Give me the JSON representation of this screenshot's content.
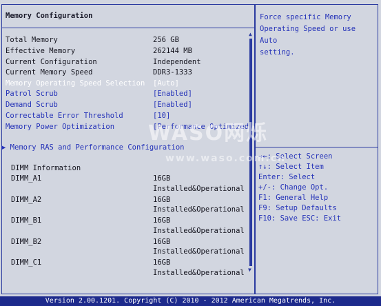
{
  "title": "Memory Configuration",
  "info_rows": [
    {
      "label": "Total Memory",
      "value": "256 GB"
    },
    {
      "label": "Effective Memory",
      "value": "262144 MB"
    },
    {
      "label": "Current Configuration",
      "value": "Independent"
    },
    {
      "label": "Current Memory Speed",
      "value": "DDR3-1333"
    }
  ],
  "options": [
    {
      "label": "Memory Operating Speed Selection",
      "value": "[Auto]"
    },
    {
      "label": "Patrol Scrub",
      "value": "[Enabled]"
    },
    {
      "label": "Demand Scrub",
      "value": "[Enabled]"
    },
    {
      "label": "Correctable Error Threshold",
      "value": "[10]"
    },
    {
      "label": "Memory Power Optimization",
      "value": "[Performance Optimized]"
    }
  ],
  "submenu": "▶ Memory RAS and Performance Configuration",
  "dimm_header": "DIMM Information",
  "dimms": [
    {
      "name": "DIMM_A1",
      "size": "16GB",
      "status": "Installed&Operational"
    },
    {
      "name": "DIMM_A2",
      "size": "16GB",
      "status": "Installed&Operational"
    },
    {
      "name": "DIMM_B1",
      "size": "16GB",
      "status": "Installed&Operational"
    },
    {
      "name": "DIMM_B2",
      "size": "16GB",
      "status": "Installed&Operational"
    },
    {
      "name": "DIMM_C1",
      "size": "16GB",
      "status": "Installed&Operational"
    }
  ],
  "help_text": "Force specific Memory\nOperating Speed or use Auto\nsetting.",
  "keys": [
    "→←: Select Screen",
    "↑↓: Select Item",
    "Enter: Select",
    "+/-: Change Opt.",
    "F1: General Help",
    "F9: Setup Defaults",
    "F10: Save  ESC: Exit"
  ],
  "footer": "Version 2.00.1201. Copyright (C) 2010 - 2012 American Megatrends, Inc.",
  "watermark": "WASO网烁",
  "watermark_url": "www.waso.com.cn",
  "colors": {
    "background": "#d2d6e0",
    "frame": "#2a3aa0",
    "option_text": "#2432b8",
    "selected_text": "#ffffff",
    "footer_bg": "#1d2a8c"
  }
}
